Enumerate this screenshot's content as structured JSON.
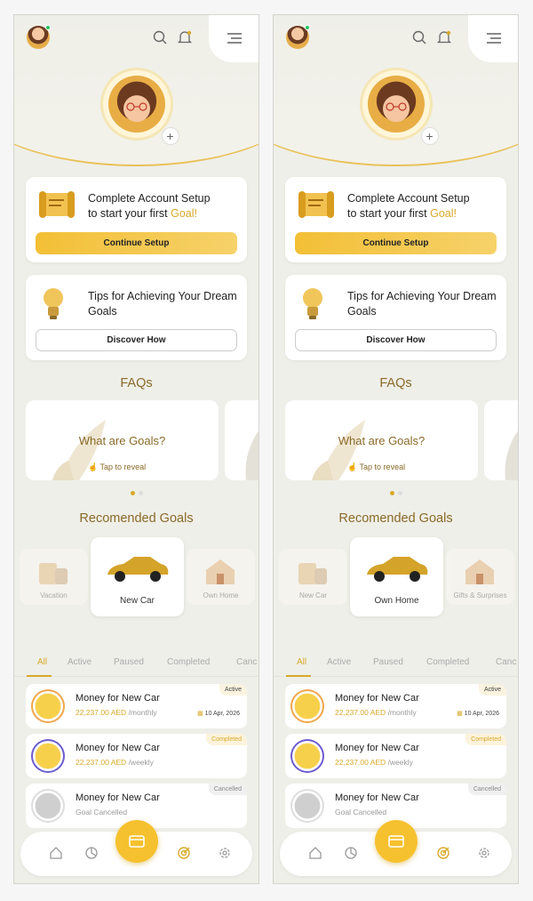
{
  "screens": [
    {
      "id": "screen-left",
      "setup": {
        "line1": "Complete Account Setup",
        "line2_prefix": "to start your first ",
        "line2_highlight": "Goal!",
        "button": "Continue Setup"
      },
      "tips": {
        "title": "Tips for Achieving Your Dream Goals",
        "button": "Discover How"
      },
      "faqs": {
        "title": "FAQs",
        "question": "What are Goals?",
        "tap": "Tap to reveal"
      },
      "recommended": {
        "title": "Recomended Goals",
        "left": "Vacation",
        "center": "New Car",
        "right": "Own Home"
      },
      "tabs": [
        "All",
        "Active",
        "Paused",
        "Completed",
        "Canc"
      ],
      "goals": [
        {
          "title": "Money for New Car",
          "amount": "22,237.00 AED",
          "period": "/monthly",
          "badge": "Active",
          "date": "10 Apr, 2026"
        },
        {
          "title": "Money for New Car",
          "amount": "22,237.00 AED",
          "period": "/weekly",
          "badge": "Completed",
          "date": ""
        },
        {
          "title": "Money for New Car",
          "amount": "",
          "period": "Goal Cancelled",
          "badge": "Cancelled",
          "date": ""
        }
      ]
    },
    {
      "id": "screen-right",
      "setup": {
        "line1": "Complete Account Setup",
        "line2_prefix": "to start your first ",
        "line2_highlight": "Goal!",
        "button": "Continue Setup"
      },
      "tips": {
        "title": "Tips for Achieving Your Dream Goals",
        "button": "Discover How"
      },
      "faqs": {
        "title": "FAQs",
        "question": "What are Goals?",
        "tap": "Tap to reveal"
      },
      "recommended": {
        "title": "Recomended Goals",
        "left": "New Car",
        "center": "Own Home",
        "right": "Gifts & Surprises"
      },
      "tabs": [
        "All",
        "Active",
        "Paused",
        "Completed",
        "Canc"
      ],
      "goals": [
        {
          "title": "Money for New Car",
          "amount": "22,237.00 AED",
          "period": "/monthly",
          "badge": "Active",
          "date": "10 Apr, 2026"
        },
        {
          "title": "Money for New Car",
          "amount": "22,237.00 AED",
          "period": "/weekly",
          "badge": "Completed",
          "date": ""
        },
        {
          "title": "Money for New Car",
          "amount": "",
          "period": "Goal Cancelled",
          "badge": "Cancelled",
          "date": ""
        }
      ]
    }
  ],
  "colors": {
    "accent": "#d8a92a",
    "brown": "#8a6a28",
    "gold_button": "#f3bf36"
  }
}
